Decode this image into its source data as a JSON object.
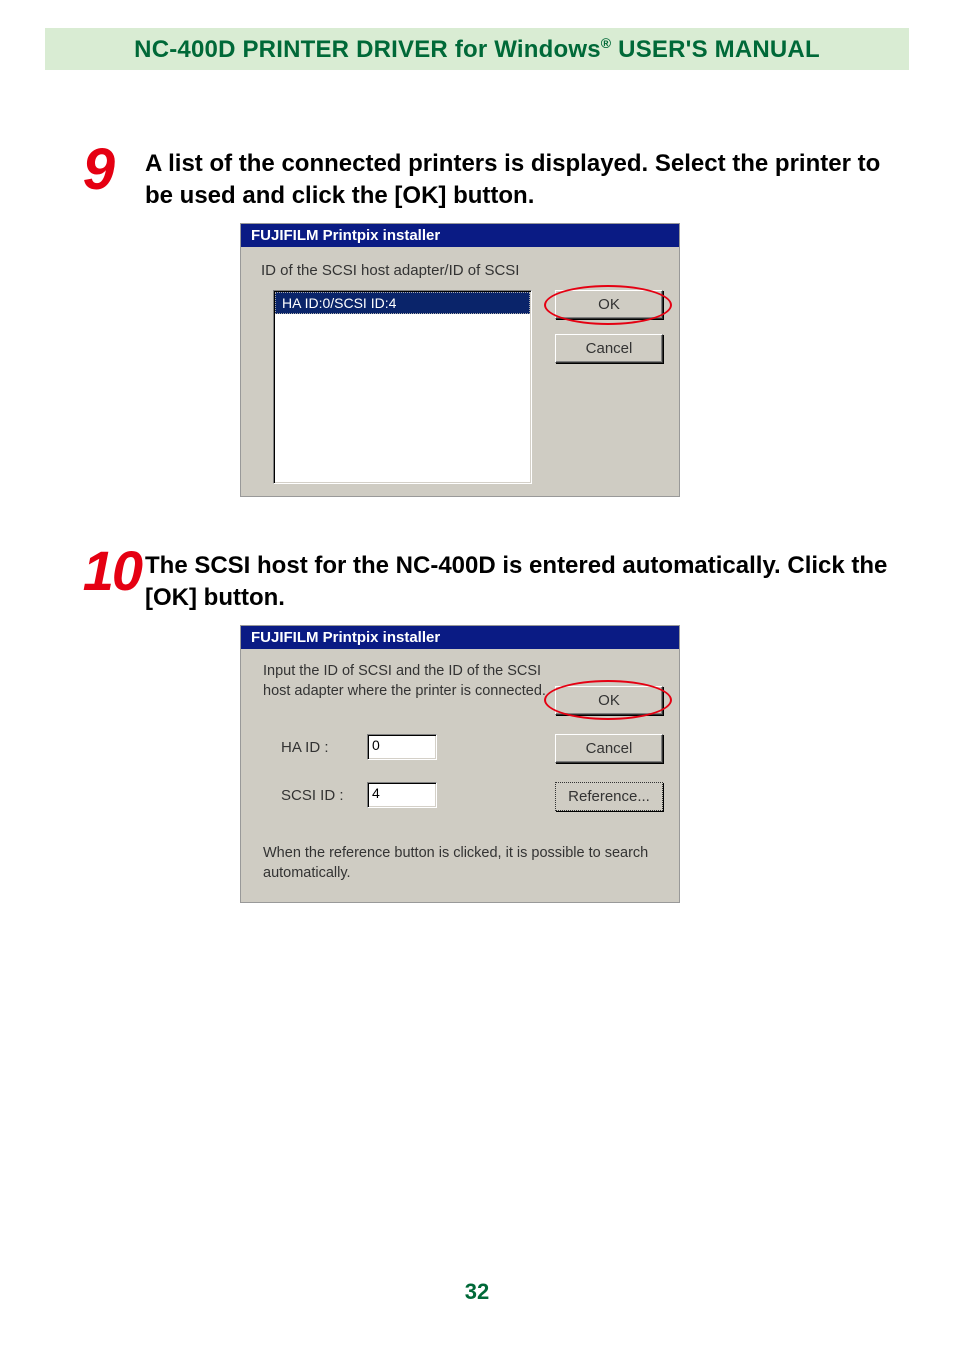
{
  "header": {
    "title_a": "NC-400D PRINTER DRIVER for Windows",
    "title_reg": "®",
    "title_b": " USER'S MANUAL"
  },
  "steps": {
    "s9": {
      "num": "9",
      "text": "A list of the connected printers is displayed. Select the printer to be used and click the [OK] button."
    },
    "s10": {
      "num": "10",
      "text": "The SCSI host for the NC-400D is entered automatically. Click the [OK] button."
    }
  },
  "ss1": {
    "window_title": "FUJIFILM Printpix installer",
    "prompt": "ID of the SCSI host adapter/ID of SCSI",
    "selected_item": "HA ID:0/SCSI ID:4",
    "ok": "OK",
    "cancel": "Cancel"
  },
  "ss2": {
    "window_title": "FUJIFILM Printpix installer",
    "prompt": "Input the ID of SCSI and the ID of the SCSI host adapter where the printer is connected.",
    "ha_label": "HA ID :",
    "ha_value": "0",
    "scsi_label": "SCSI ID :",
    "scsi_value": "4",
    "ok": "OK",
    "cancel": "Cancel",
    "reference": "Reference...",
    "footer": "When the reference button is clicked, it is possible to search automatically."
  },
  "page_number": "32"
}
